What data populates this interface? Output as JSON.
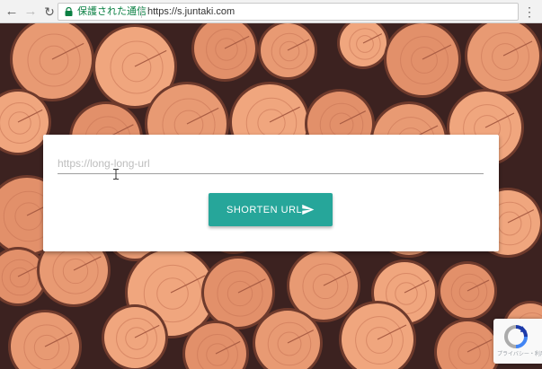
{
  "browser": {
    "secure_label": "保護された通信",
    "url": "https://s.juntaki.com",
    "icons": {
      "back": "arrow-left",
      "forward": "arrow-right",
      "reload": "reload",
      "lock": "lock",
      "menu": "vertical-ellipsis"
    }
  },
  "form": {
    "url_placeholder": "https://long-long-url",
    "url_value": "",
    "submit_label": "SHORTEN URL",
    "submit_icon": "send",
    "accent_color": "#26a69a"
  },
  "recaptcha": {
    "text": "プライバシー・利用規約"
  }
}
